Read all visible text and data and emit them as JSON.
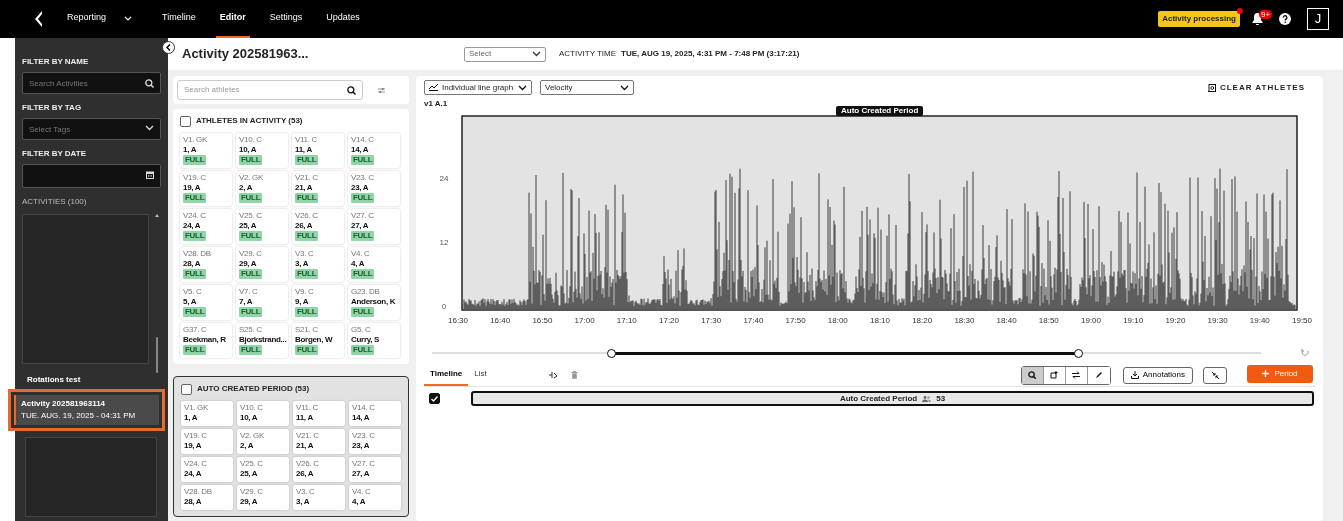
{
  "top_nav": {
    "items": [
      {
        "label": "Reporting",
        "kind": "dropdown",
        "selected": false
      },
      {
        "label": "Timeline",
        "kind": "link",
        "selected": false
      },
      {
        "label": "Editor",
        "kind": "link",
        "selected": true
      },
      {
        "label": "Settings",
        "kind": "link",
        "selected": false
      },
      {
        "label": "Updates",
        "kind": "link",
        "selected": false
      }
    ],
    "status_badge": "Activity processing",
    "notification_count": "9+",
    "avatar": "J"
  },
  "sidebar": {
    "filters": [
      {
        "label": "FILTER BY NAME",
        "kind": "search",
        "placeholder": "Search Activities"
      },
      {
        "label": "FILTER BY TAG",
        "kind": "select",
        "placeholder": "Select Tags"
      },
      {
        "label": "FILTER BY DATE",
        "kind": "date"
      }
    ],
    "activities_label": "ACTIVITIES (100)",
    "activities": [
      {
        "title": "Rotations test",
        "selected": false
      },
      {
        "title": "Activity 202581963114",
        "date": "TUE. AUG. 19, 2025 - 04:31 PM",
        "selected": true
      }
    ]
  },
  "header": {
    "title": "Activity 202581963...",
    "select_placeholder": "Select",
    "time_label": "ACTIVITY TIME",
    "time_value": "TUE, AUG 19, 2025, 4:31 PM - 7:48 PM (3:17:21)"
  },
  "athletes": {
    "search_placeholder": "Search athletes",
    "groups": [
      {
        "title": "ATHLETES IN ACTIVITY (53)",
        "checked": false,
        "highlighted": false,
        "athletes": [
          {
            "position": "V1. GK",
            "name": "1, A",
            "status": "FULL"
          },
          {
            "position": "V10. C",
            "name": "10, A",
            "status": "FULL"
          },
          {
            "position": "V11. C",
            "name": "11, A",
            "status": "FULL"
          },
          {
            "position": "V14. C",
            "name": "14, A",
            "status": "FULL"
          },
          {
            "position": "V19. C",
            "name": "19, A",
            "status": "FULL"
          },
          {
            "position": "V2. GK",
            "name": "2, A",
            "status": "FULL"
          },
          {
            "position": "V21. C",
            "name": "21, A",
            "status": "FULL"
          },
          {
            "position": "V23. C",
            "name": "23, A",
            "status": "FULL"
          },
          {
            "position": "V24. C",
            "name": "24, A",
            "status": "FULL"
          },
          {
            "position": "V25. C",
            "name": "25, A",
            "status": "FULL"
          },
          {
            "position": "V26. C",
            "name": "26, A",
            "status": "FULL"
          },
          {
            "position": "V27. C",
            "name": "27, A",
            "status": "FULL"
          },
          {
            "position": "V28. DB",
            "name": "28, A",
            "status": "FULL"
          },
          {
            "position": "V29. C",
            "name": "29, A",
            "status": "FULL"
          },
          {
            "position": "V3. C",
            "name": "3, A",
            "status": "FULL"
          },
          {
            "position": "V4. C",
            "name": "4, A",
            "status": "FULL"
          },
          {
            "position": "V5. C",
            "name": "5, A",
            "status": "FULL"
          },
          {
            "position": "V7. C",
            "name": "7, A",
            "status": "FULL"
          },
          {
            "position": "V9. C",
            "name": "9, A",
            "status": "FULL"
          },
          {
            "position": "G23. DB",
            "name": "Anderson, K",
            "status": "FULL"
          },
          {
            "position": "G37. C",
            "name": "Beekman, R",
            "status": "FULL"
          },
          {
            "position": "S25. C",
            "name": "Bjorkstrand...",
            "status": "FULL"
          },
          {
            "position": "S21. C",
            "name": "Borgen, W",
            "status": "FULL"
          },
          {
            "position": "G5. C",
            "name": "Curry, S",
            "status": "FULL"
          }
        ]
      },
      {
        "title": "AUTO CREATED PERIOD (53)",
        "checked": false,
        "highlighted": true,
        "athletes": [
          {
            "position": "V1. GK",
            "name": "1, A"
          },
          {
            "position": "V10. C",
            "name": "10, A"
          },
          {
            "position": "V11. C",
            "name": "11, A"
          },
          {
            "position": "V14. C",
            "name": "14, A"
          },
          {
            "position": "V19. C",
            "name": "19, A"
          },
          {
            "position": "V2. GK",
            "name": "2, A"
          },
          {
            "position": "V21. C",
            "name": "21, A"
          },
          {
            "position": "V23. C",
            "name": "23, A"
          },
          {
            "position": "V24. C",
            "name": "24, A"
          },
          {
            "position": "V25. C",
            "name": "25, A"
          },
          {
            "position": "V26. C",
            "name": "26, A"
          },
          {
            "position": "V27. C",
            "name": "27, A"
          },
          {
            "position": "V28. DB",
            "name": "28, A"
          },
          {
            "position": "V29. C",
            "name": "29, A"
          },
          {
            "position": "V3. C",
            "name": "3, A"
          },
          {
            "position": "V4. C",
            "name": "4, A"
          }
        ]
      }
    ]
  },
  "chart_panel": {
    "graph_type": "Individual line graph",
    "metric": "Velocity",
    "clear_label": "CLEAR ATHLETES",
    "series_label": "v1 A.1",
    "period_label": "Auto Created Period",
    "y_ticks": [
      "24",
      "12",
      "0"
    ],
    "x_ticks": [
      "16:30",
      "16:40",
      "16:50",
      "17:00",
      "17:10",
      "17:20",
      "17:30",
      "17:40",
      "17:50",
      "18:00",
      "18:10",
      "18:20",
      "18:30",
      "18:40",
      "18:50",
      "19:00",
      "19:10",
      "19:20",
      "19:30",
      "19:40",
      "19:50"
    ],
    "range_handles": [
      {
        "level": 0.217
      },
      {
        "level": 0.78
      }
    ]
  },
  "timeline": {
    "tabs": [
      {
        "label": "Timeline",
        "selected": true
      },
      {
        "label": "List",
        "selected": false
      }
    ],
    "tools": [
      {
        "kind": "zoom",
        "selected": true
      },
      {
        "kind": "crop",
        "selected": false
      },
      {
        "kind": "swap",
        "selected": false
      },
      {
        "kind": "pen",
        "selected": false
      }
    ],
    "annotations_label": "Annotations",
    "add_label": "Period",
    "periods": [
      {
        "label": "Auto Created Period",
        "count": "53",
        "checked": true
      }
    ]
  }
}
